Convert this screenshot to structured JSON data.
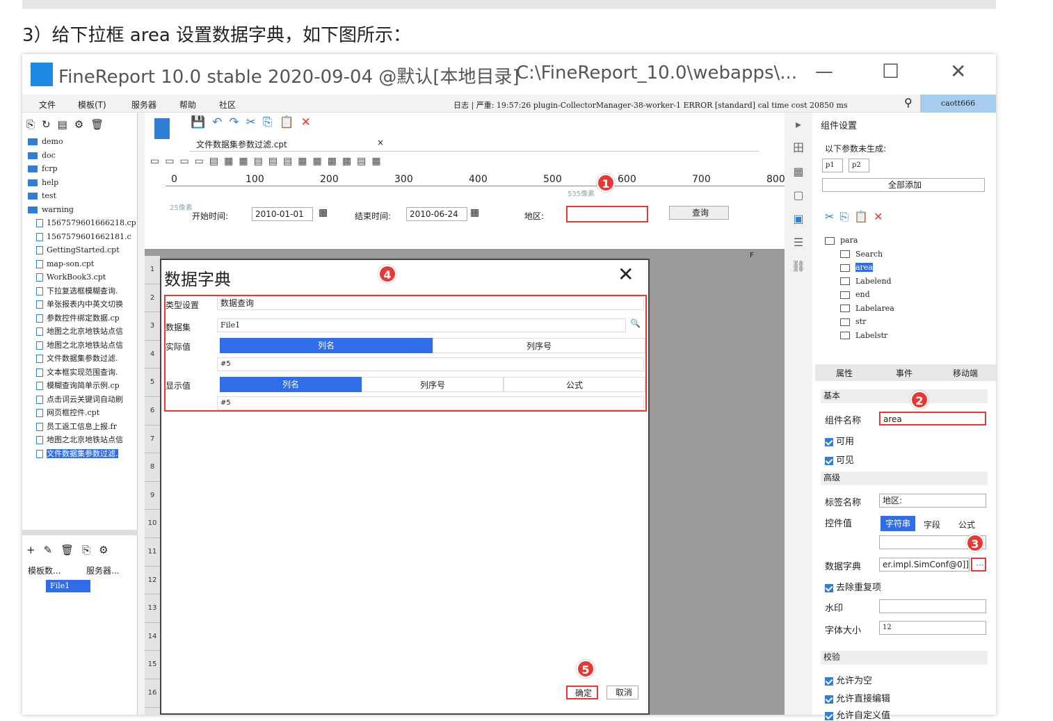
{
  "heading": "3）给下拉框 area 设置数据字典，如下图所示：",
  "window": {
    "title": "FineReport 10.0 stable 2020-09-04 @默认[本地目录]",
    "path": "C:\\FineReport_10.0\\webapps\\...",
    "min": "—",
    "max": "☐",
    "close": "✕"
  },
  "menu": [
    "文件",
    "模板(T)",
    "服务器",
    "帮助",
    "社区"
  ],
  "log": "日志 | 严重: 19:57:26 plugin-CollectorManager-38-worker-1 ERROR [standard] cal time cost 20850 ms",
  "user": "caott666",
  "tree": [
    {
      "t": "f",
      "n": "demo"
    },
    {
      "t": "f",
      "n": "doc"
    },
    {
      "t": "f",
      "n": "fcrp"
    },
    {
      "t": "f",
      "n": "help"
    },
    {
      "t": "f",
      "n": "test"
    },
    {
      "t": "f",
      "n": "warning"
    },
    {
      "t": "d",
      "n": "1567579601666218.cp"
    },
    {
      "t": "d",
      "n": "1567579601662181.c"
    },
    {
      "t": "d",
      "n": "GettingStarted.cpt"
    },
    {
      "t": "d",
      "n": "map-son.cpt"
    },
    {
      "t": "d",
      "n": "WorkBook3.cpt"
    },
    {
      "t": "d",
      "n": "下拉复选框模糊查询."
    },
    {
      "t": "d",
      "n": "单张报表内中英文切换"
    },
    {
      "t": "d",
      "n": "参数控件绑定数据.cp"
    },
    {
      "t": "d",
      "n": "地图之北京地铁站点信"
    },
    {
      "t": "d",
      "n": "地图之北京地铁站点信"
    },
    {
      "t": "d",
      "n": "文件数据集参数过滤."
    },
    {
      "t": "d",
      "n": "文本框实现范围查询."
    },
    {
      "t": "d",
      "n": "模糊查询简单示例.cp"
    },
    {
      "t": "d",
      "n": "点击词云关键词自动刷"
    },
    {
      "t": "d",
      "n": "网页框控件.cpt"
    },
    {
      "t": "d",
      "n": "员工返工信息上报.fr"
    },
    {
      "t": "d",
      "n": "地图之北京地铁站点信"
    },
    {
      "t": "s",
      "n": "文件数据集参数过滤."
    }
  ],
  "ds_tabs": [
    "模板数...",
    "服务器..."
  ],
  "ds_item": "File1",
  "tab_file": "文件数据集参数过滤.cpt",
  "ruler": [
    "0",
    "100",
    "200",
    "300",
    "400",
    "500",
    "600",
    "700",
    "800"
  ],
  "param": {
    "start_label": "开始时间:",
    "start_val": "2010-01-01",
    "end_label": "结束时间:",
    "end_val": "2010-06-24",
    "area_label": "地区:",
    "query": "查询",
    "px1": "25像素",
    "px2": "535像素"
  },
  "rows": [
    "1",
    "2",
    "3",
    "4",
    "5",
    "6",
    "7",
    "8",
    "9",
    "10",
    "11",
    "12",
    "13",
    "14",
    "15",
    "16"
  ],
  "colF": "F",
  "dialog": {
    "title": "数据字典",
    "close": "✕",
    "type_label": "类型设置",
    "type_val": "数据查询",
    "ds_label": "数据集",
    "ds_val": "File1",
    "actual_label": "实际值",
    "actual_tabs": [
      "列名",
      "列序号"
    ],
    "actual_val": "#5",
    "display_label": "显示值",
    "display_tabs": [
      "列名",
      "列序号",
      "公式"
    ],
    "display_val": "#5",
    "ok": "确定",
    "cancel": "取消"
  },
  "right": {
    "title": "组件设置",
    "ungen": "以下参数未生成:",
    "params": [
      "p1",
      "p2"
    ],
    "addall": "全部添加",
    "widgets": [
      "para",
      "Search",
      "area",
      "Labelend",
      "end",
      "Labelarea",
      "str",
      "Labelstr"
    ],
    "tabs": [
      "属性",
      "事件",
      "移动端"
    ],
    "basic": "基本",
    "name_label": "组件名称",
    "name_val": "area",
    "enabled": "可用",
    "visible": "可见",
    "adv": "高级",
    "tag_label": "标签名称",
    "tag_val": "地区:",
    "ctrl_label": "控件值",
    "ctrl_tabs": [
      "字符串",
      "字段",
      "公式"
    ],
    "dict_label": "数据字典",
    "dict_val": "er.impl.SimConf@0]]",
    "dedup": "去除重复项",
    "wm": "水印",
    "fs_label": "字体大小",
    "fs_val": "12",
    "check": "校验",
    "allow_empty": "允许为空",
    "allow_edit": "允许直接编辑",
    "allow_custom": "允许自定义值"
  },
  "badges": [
    "1",
    "2",
    "3",
    "4",
    "5"
  ]
}
